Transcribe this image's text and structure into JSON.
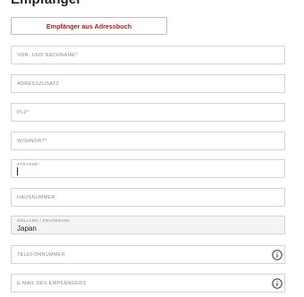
{
  "heading": "Empfänger",
  "address_book_button": "Empfänger aus Adressbuch",
  "fields": {
    "name": {
      "placeholder": "VOR- UND NACHNAME*"
    },
    "address_extra": {
      "placeholder": "ADRESSZUSATZ"
    },
    "zip": {
      "placeholder": "PLZ*"
    },
    "city": {
      "placeholder": "WOHNORT*"
    },
    "street": {
      "label": "STRASSE*",
      "value": ""
    },
    "house_number": {
      "placeholder": "HAUSNUMMER"
    },
    "country": {
      "label": "ZIELLAND / ZIELREGION",
      "value": "Japan"
    },
    "phone": {
      "placeholder": "TELEFONNUMMER"
    },
    "email": {
      "placeholder": "E-MAIL DES EMPFÄNGERS"
    }
  },
  "icons": {
    "phone_info": "info-icon",
    "email_info": "info-icon"
  },
  "colors": {
    "accent": "#9c1c1c",
    "border": "#d4d4d4",
    "disabled_bg": "#f4f4f4"
  }
}
